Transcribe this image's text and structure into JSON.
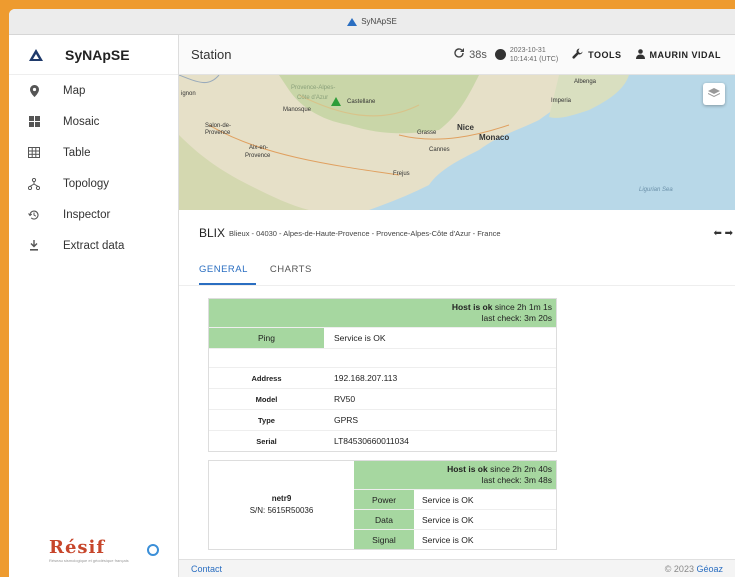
{
  "window": {
    "title": "SyNApSE"
  },
  "sidebar": {
    "brand": "SyNApSE",
    "items": [
      {
        "label": "Map",
        "icon": "map-pin-icon"
      },
      {
        "label": "Mosaic",
        "icon": "mosaic-icon"
      },
      {
        "label": "Table",
        "icon": "table-icon"
      },
      {
        "label": "Topology",
        "icon": "topology-icon"
      },
      {
        "label": "Inspector",
        "icon": "history-icon"
      },
      {
        "label": "Extract data",
        "icon": "download-icon"
      }
    ],
    "footer_logo": "Résif",
    "footer_logo_sub": "Réseau sismologique et géodésique français"
  },
  "header": {
    "title": "Station",
    "refresh": "38s",
    "date": "2023-10-31",
    "time": "10:14:41 (UTC)",
    "tools_label": "TOOLS",
    "user_label": "MAURIN VIDAL"
  },
  "map": {
    "labels": {
      "l1": "ignon",
      "l2": "Provence-Alpes-",
      "l3": "Côte d'Azur",
      "l4": "Castellane",
      "l5": "Manosque",
      "l6": "Albenga",
      "l7": "Imperia",
      "l8": "Salon-de-",
      "l9": "Provence",
      "l10": "Aix-en-",
      "l11": "Provence",
      "l12": "Grasse",
      "l13": "Nice",
      "l14": "Monaco",
      "l15": "Cannes",
      "l16": "Frejus",
      "l17": "Ligurian Sea"
    }
  },
  "station": {
    "code": "BLIX",
    "location": "Blieux - 04030 - Alpes-de-Haute-Provence - Provence-Alpes-Côte d'Azur - France"
  },
  "tabs": [
    {
      "label": "GENERAL",
      "active": true
    },
    {
      "label": "CHARTS",
      "active": false
    }
  ],
  "host_card": {
    "status_strong": "Host is ok",
    "status_since": "since 2h 1m 1s",
    "last_check": "last check: 3m 20s",
    "ping_label": "Ping",
    "ping_value": "Service is OK",
    "fields": [
      {
        "key": "Address",
        "value": "192.168.207.113"
      },
      {
        "key": "Model",
        "value": "RV50"
      },
      {
        "key": "Type",
        "value": "GPRS"
      },
      {
        "key": "Serial",
        "value": "LT84530660011034"
      }
    ]
  },
  "device_card": {
    "name": "netr9",
    "serial": "S/N: 5615R50036",
    "status_strong": "Host is ok",
    "status_since": "since 2h 2m 40s",
    "last_check": "last check: 3m 48s",
    "services": [
      {
        "key": "Power",
        "value": "Service is OK"
      },
      {
        "key": "Data",
        "value": "Service is OK"
      },
      {
        "key": "Signal",
        "value": "Service is OK"
      }
    ]
  },
  "footer": {
    "contact": "Contact",
    "copyright": "© 2023",
    "org": "Géoaz"
  },
  "colors": {
    "accent": "#2a6ec1",
    "ok_green": "#a6d7a0",
    "frame": "#ee9b2f"
  }
}
